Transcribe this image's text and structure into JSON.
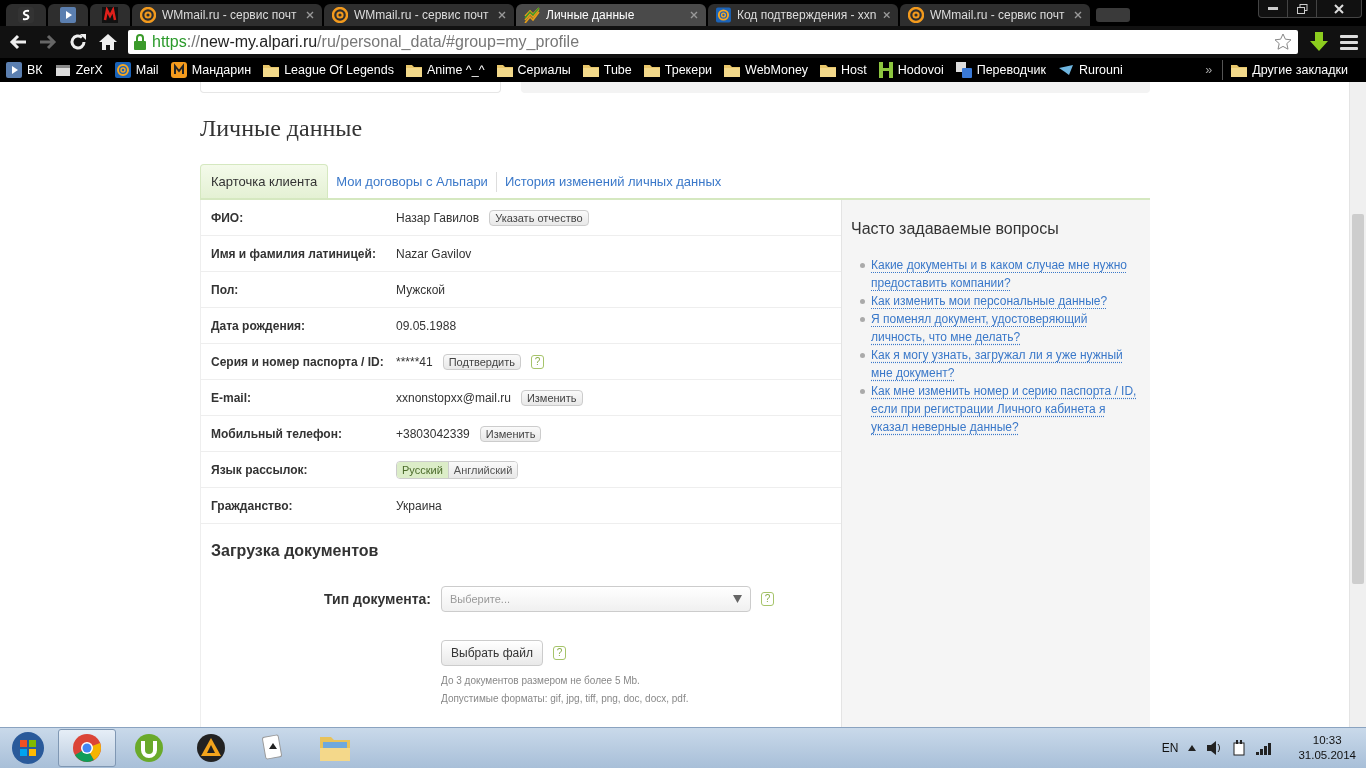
{
  "browser": {
    "tabs": [
      {
        "kind": "s-app",
        "selected": false
      },
      {
        "kind": "play",
        "selected": false
      },
      {
        "kind": "m-app",
        "selected": false
      },
      {
        "kind": "at",
        "title": "WMmail.ru - сервис почт",
        "selected": false
      },
      {
        "kind": "at",
        "title": "WMmail.ru - сервис почт",
        "selected": false
      },
      {
        "kind": "chart",
        "title": "Личные данные",
        "selected": true
      },
      {
        "kind": "at-blue",
        "title": "Код подтверждения - xxn",
        "selected": false
      },
      {
        "kind": "at",
        "title": "WMmail.ru - сервис почт",
        "selected": false
      }
    ],
    "url": {
      "scheme": "https",
      "sep": "://",
      "host": "new-my.alpari.ru",
      "path": "/ru/personal_data/#group=my_profile"
    },
    "bookmarks": [
      {
        "kind": "play",
        "label": "ВК"
      },
      {
        "kind": "clapper",
        "label": "ZerX"
      },
      {
        "kind": "at-blue",
        "label": "Mail"
      },
      {
        "kind": "m-orange",
        "label": "Мандарин"
      },
      {
        "kind": "folder",
        "label": "League Of Legends"
      },
      {
        "kind": "folder",
        "label": "Anime ^_^"
      },
      {
        "kind": "folder",
        "label": "Сериалы"
      },
      {
        "kind": "folder",
        "label": "Tube"
      },
      {
        "kind": "folder",
        "label": "Трекери"
      },
      {
        "kind": "folder",
        "label": "WebMoney"
      },
      {
        "kind": "folder",
        "label": "Host"
      },
      {
        "kind": "h-green",
        "label": "Hodovoi"
      },
      {
        "kind": "translate",
        "label": "Переводчик"
      },
      {
        "kind": "bird",
        "label": "Rurouni"
      }
    ],
    "overflow": "»",
    "other_bookmarks": "Другие закладки"
  },
  "page": {
    "title": "Личные данные",
    "tabs": [
      {
        "label": "Карточка клиента",
        "selected": true
      },
      {
        "label": "Мои договоры с Альпари",
        "selected": false
      },
      {
        "label": "История изменений личных данных",
        "selected": false
      }
    ],
    "fields": [
      {
        "kind": "text",
        "label": "ФИО:",
        "value": "Назар Гавилов",
        "button": "Указать отчество"
      },
      {
        "kind": "text",
        "label": "Имя и фамилия латиницей:",
        "value": "Nazar Gavilov"
      },
      {
        "kind": "text",
        "label": "Пол:",
        "value": "Мужской"
      },
      {
        "kind": "text",
        "label": "Дата рождения:",
        "value": "09.05.1988"
      },
      {
        "kind": "text",
        "label": "Серия и номер паспорта / ID:",
        "value": "*****41",
        "button": "Подтвердить",
        "help": "?"
      },
      {
        "kind": "text",
        "label": "E-mail:",
        "value": "xxnonstopxx@mail.ru",
        "button": "Изменить"
      },
      {
        "kind": "text",
        "label": "Мобильный телефон:",
        "value": "+3803042339",
        "button": "Изменить"
      },
      {
        "kind": "toggle",
        "label": "Язык рассылок:",
        "options": [
          {
            "label": "Русский",
            "selected": true
          },
          {
            "label": "Английский",
            "selected": false
          }
        ]
      },
      {
        "kind": "text",
        "label": "Гражданство:",
        "value": "Украина"
      }
    ],
    "upload": {
      "heading": "Загрузка документов",
      "type_label": "Тип документа:",
      "type_placeholder": "Выберите...",
      "type_help": "?",
      "file_button": "Выбрать файл",
      "file_help": "?",
      "notes": [
        "До 3 документов размером не более 5 Mb.",
        "Допустимые форматы: gif, jpg, tiff, png, doc, docx, pdf."
      ]
    },
    "faq": {
      "title": "Часто задаваемые вопросы",
      "items": [
        "Какие документы и в каком случае мне нужно предоставить компании?",
        "Как изменить мои персональные данные?",
        "Я поменял документ, удостоверяющий личность, что мне делать?",
        "Как я могу узнать, загружал ли я уже нужный мне документ?",
        "Как мне изменить номер и серию паспорта / ID, если при регистрации Личного кабинета я указал неверные данные?"
      ]
    }
  },
  "taskbar": {
    "apps": [
      {
        "kind": "browser",
        "selected": true
      },
      {
        "kind": "torrent",
        "selected": false
      },
      {
        "kind": "player",
        "selected": false
      },
      {
        "kind": "cards",
        "selected": false
      },
      {
        "kind": "explorer",
        "selected": false
      }
    ],
    "language": "EN",
    "time": "10:33",
    "date": "31.05.2014"
  }
}
